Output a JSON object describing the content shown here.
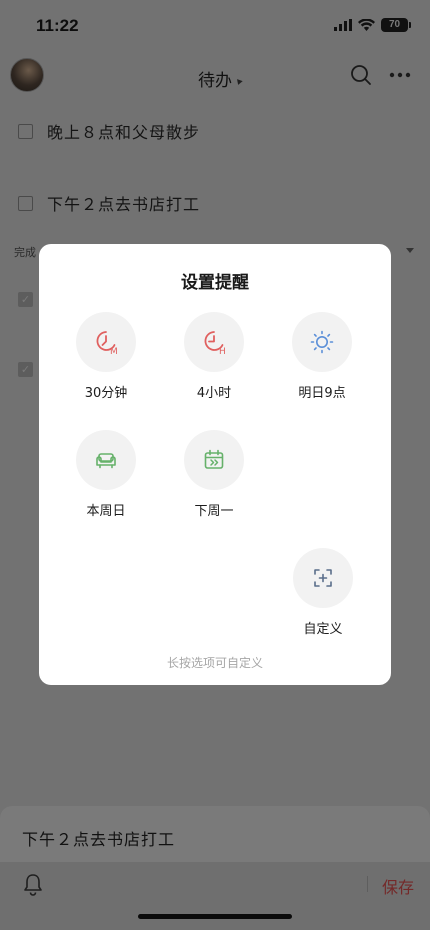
{
  "status_bar": {
    "time": "11:22",
    "battery": "70"
  },
  "header": {
    "title": "待办"
  },
  "tasks": [
    {
      "text": "晚上８点和父母散步"
    },
    {
      "text": "下午２点去书店打工"
    }
  ],
  "done_section": {
    "label": "完成"
  },
  "dialog": {
    "title": "设置提醒",
    "options": [
      {
        "label": "30分钟",
        "icon": "clock-m-icon"
      },
      {
        "label": "4小时",
        "icon": "clock-h-icon"
      },
      {
        "label": "明日9点",
        "icon": "sun-icon"
      },
      {
        "label": "本周日",
        "icon": "sofa-icon"
      },
      {
        "label": "下周一",
        "icon": "calendar-next-icon"
      },
      {
        "label": "自定义",
        "icon": "custom-add-icon"
      }
    ],
    "hint": "长按选项可自定义"
  },
  "bottom_sheet": {
    "input_value": "下午２点去书店打工",
    "save_label": "保存"
  },
  "colors": {
    "overlay": "#727272",
    "accent_red": "#e0605f",
    "accent_blue": "#5b8fd8",
    "accent_green": "#66b16a",
    "save_text": "#742929"
  }
}
